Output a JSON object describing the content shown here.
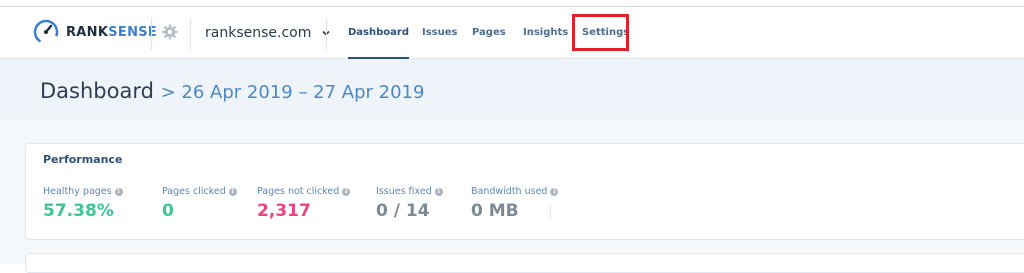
{
  "brand": {
    "name_dark": "RANK",
    "name_accent": "SENSE"
  },
  "site_selector": {
    "value": "ranksense.com"
  },
  "nav": {
    "tabs": [
      {
        "label": "Dashboard",
        "active": true
      },
      {
        "label": "Issues",
        "active": false
      },
      {
        "label": "Pages",
        "active": false
      },
      {
        "label": "Insights",
        "active": false
      },
      {
        "label": "Settings",
        "active": false,
        "highlighted": true
      }
    ]
  },
  "header": {
    "title": "Dashboard",
    "date_range": "> 26 Apr 2019 – 27 Apr 2019"
  },
  "performance": {
    "title": "Performance",
    "metrics": [
      {
        "label": "Healthy pages",
        "value": "57.38%",
        "color": "#3fc494"
      },
      {
        "label": "Pages clicked",
        "value": "0",
        "color": "#3fc494"
      },
      {
        "label": "Pages not clicked",
        "value": "2,317",
        "color": "#e8467c"
      },
      {
        "label": "Issues fixed",
        "value": "0 / 14",
        "color": "#7c8a96"
      },
      {
        "label": "Bandwidth used",
        "value": "0 MB",
        "color": "#7c8a96"
      }
    ]
  },
  "colors": {
    "accent": "#2c4f7c",
    "brand_blue": "#3c7fcb",
    "highlight": "#e0202a",
    "positive": "#3fc494",
    "negative": "#e8467c"
  },
  "icons": {
    "logo": "gauge-icon",
    "settings": "gear-icon",
    "dropdown": "chevron-down-icon",
    "info": "info-icon"
  }
}
